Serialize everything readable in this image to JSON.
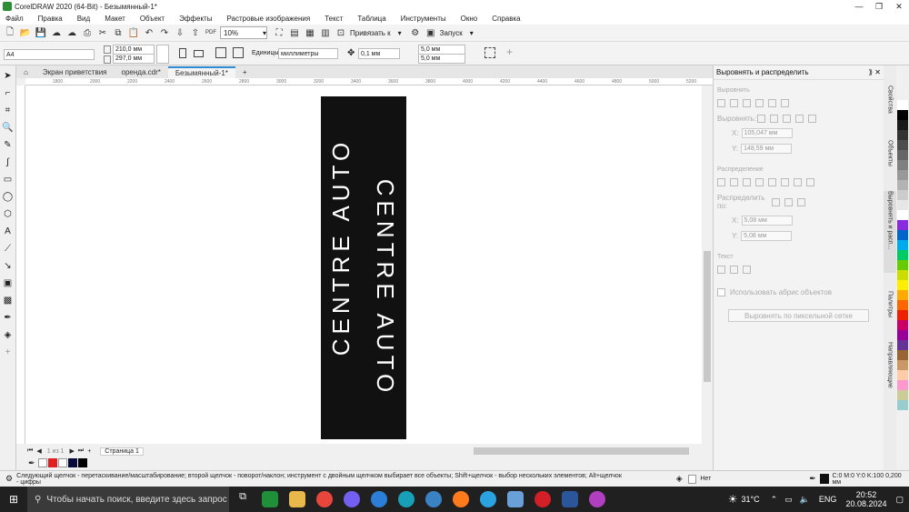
{
  "title_bar": {
    "title": "CorelDRAW 2020 (64-Bit) - Безымянный-1*"
  },
  "menu": [
    "Файл",
    "Правка",
    "Вид",
    "Макет",
    "Объект",
    "Эффекты",
    "Растровые изображения",
    "Текст",
    "Таблица",
    "Инструменты",
    "Окно",
    "Справка"
  ],
  "toolbar": {
    "zoom": "10%",
    "snap_label": "Привязать к",
    "launch_label": "Запуск"
  },
  "property_bar": {
    "page_size": "A4",
    "width": "210,0 мм",
    "height": "297,0 мм",
    "units_label": "Единицы:",
    "units_value": "миллиметры",
    "nudge": "0,1 мм",
    "dup_x": "5,0 мм",
    "dup_y": "5,0 мм"
  },
  "doc_tabs": [
    "Экран приветствия",
    "оренда.cdr*",
    "Безымянный-1*"
  ],
  "ruler_labels": [
    "1800",
    "2000",
    "2200",
    "2400",
    "2600",
    "2800",
    "3000",
    "3200",
    "3400",
    "3600",
    "3800",
    "4000",
    "4200",
    "4400",
    "4600",
    "4800",
    "5000",
    "5200"
  ],
  "canvas": {
    "text_left": "CENTRE AUTO",
    "text_right": "CENTRE AUTO"
  },
  "page_nav": {
    "counter": "1 из 1",
    "page_tab": "Страница 1"
  },
  "panel": {
    "title": "Выровнять и распределить",
    "section_align": "Выровнять",
    "align_to": "Выровнять:",
    "x_value": "105,047 мм",
    "y_value": "148,59 мм",
    "section_distribute": "Распределение",
    "distribute_to": "Распределить по:",
    "dist_x": "5,08 мм",
    "dist_y": "5,08 мм",
    "section_text": "Текст",
    "outline_checkbox": "Использовать абрис объектов",
    "pixel_grid_button": "Выровнять по пиксельной сетке"
  },
  "vertical_tabs": [
    "Свойства",
    "Объекты",
    "Выровнять и расп...",
    "Палитры",
    "Направляющие"
  ],
  "status": {
    "hint": "Следующий щелчок - перетаскивание/масштабирование; второй щелчок - поворот/наклон; инструмент с двойным щелчком выбирает все объекты; Shift+щелчок - выбор нескольких элементов; Alt+щелчок - цифры",
    "fill_none": "Нет",
    "outline_info": "C:0 M:0 Y:0 K:100  0,200 мм"
  },
  "taskbar": {
    "search_placeholder": "Чтобы начать поиск, введите здесь запрос",
    "temperature": "31°C",
    "language": "ENG",
    "time": "20:52",
    "date": "20.08.2024"
  },
  "colors": {
    "accent": "#2e8bd6",
    "object_fill": "#111111",
    "palette": [
      "#ffffff",
      "#000000",
      "#1a1a1a",
      "#333333",
      "#4d4d4d",
      "#666666",
      "#808080",
      "#999999",
      "#b3b3b3",
      "#cccccc",
      "#e6e6e6",
      "#ffffff",
      "#8a2be2",
      "#0066cc",
      "#00aaee",
      "#00cc66",
      "#66cc00",
      "#ccdd00",
      "#ffee00",
      "#ffaa00",
      "#ff6600",
      "#ee2200",
      "#cc0066",
      "#990099",
      "#663399",
      "#996633",
      "#cc9966",
      "#ffccaa",
      "#ff99cc",
      "#cccc99",
      "#99cccc"
    ]
  }
}
